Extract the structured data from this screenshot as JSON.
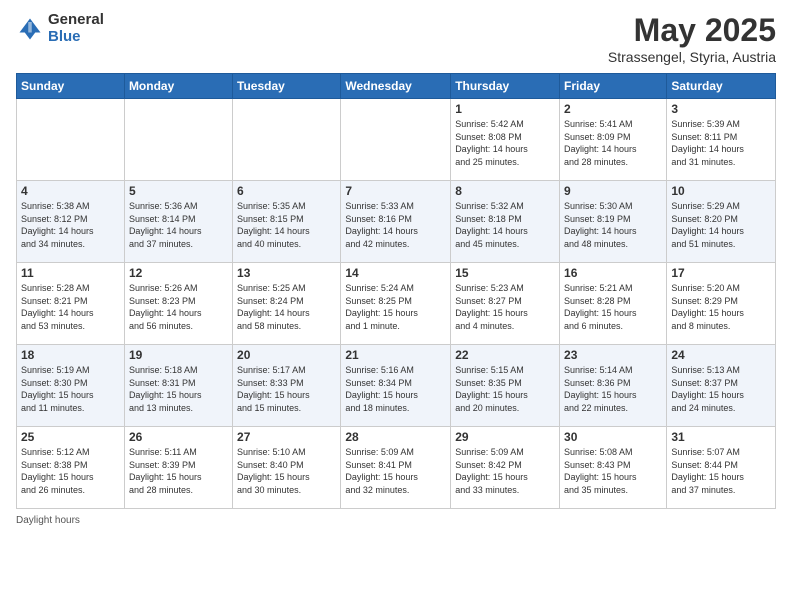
{
  "header": {
    "logo_general": "General",
    "logo_blue": "Blue",
    "title": "May 2025",
    "location": "Strassengel, Styria, Austria"
  },
  "days_of_week": [
    "Sunday",
    "Monday",
    "Tuesday",
    "Wednesday",
    "Thursday",
    "Friday",
    "Saturday"
  ],
  "weeks": [
    [
      {
        "day": "",
        "info": ""
      },
      {
        "day": "",
        "info": ""
      },
      {
        "day": "",
        "info": ""
      },
      {
        "day": "",
        "info": ""
      },
      {
        "day": "1",
        "info": "Sunrise: 5:42 AM\nSunset: 8:08 PM\nDaylight: 14 hours\nand 25 minutes."
      },
      {
        "day": "2",
        "info": "Sunrise: 5:41 AM\nSunset: 8:09 PM\nDaylight: 14 hours\nand 28 minutes."
      },
      {
        "day": "3",
        "info": "Sunrise: 5:39 AM\nSunset: 8:11 PM\nDaylight: 14 hours\nand 31 minutes."
      }
    ],
    [
      {
        "day": "4",
        "info": "Sunrise: 5:38 AM\nSunset: 8:12 PM\nDaylight: 14 hours\nand 34 minutes."
      },
      {
        "day": "5",
        "info": "Sunrise: 5:36 AM\nSunset: 8:14 PM\nDaylight: 14 hours\nand 37 minutes."
      },
      {
        "day": "6",
        "info": "Sunrise: 5:35 AM\nSunset: 8:15 PM\nDaylight: 14 hours\nand 40 minutes."
      },
      {
        "day": "7",
        "info": "Sunrise: 5:33 AM\nSunset: 8:16 PM\nDaylight: 14 hours\nand 42 minutes."
      },
      {
        "day": "8",
        "info": "Sunrise: 5:32 AM\nSunset: 8:18 PM\nDaylight: 14 hours\nand 45 minutes."
      },
      {
        "day": "9",
        "info": "Sunrise: 5:30 AM\nSunset: 8:19 PM\nDaylight: 14 hours\nand 48 minutes."
      },
      {
        "day": "10",
        "info": "Sunrise: 5:29 AM\nSunset: 8:20 PM\nDaylight: 14 hours\nand 51 minutes."
      }
    ],
    [
      {
        "day": "11",
        "info": "Sunrise: 5:28 AM\nSunset: 8:21 PM\nDaylight: 14 hours\nand 53 minutes."
      },
      {
        "day": "12",
        "info": "Sunrise: 5:26 AM\nSunset: 8:23 PM\nDaylight: 14 hours\nand 56 minutes."
      },
      {
        "day": "13",
        "info": "Sunrise: 5:25 AM\nSunset: 8:24 PM\nDaylight: 14 hours\nand 58 minutes."
      },
      {
        "day": "14",
        "info": "Sunrise: 5:24 AM\nSunset: 8:25 PM\nDaylight: 15 hours\nand 1 minute."
      },
      {
        "day": "15",
        "info": "Sunrise: 5:23 AM\nSunset: 8:27 PM\nDaylight: 15 hours\nand 4 minutes."
      },
      {
        "day": "16",
        "info": "Sunrise: 5:21 AM\nSunset: 8:28 PM\nDaylight: 15 hours\nand 6 minutes."
      },
      {
        "day": "17",
        "info": "Sunrise: 5:20 AM\nSunset: 8:29 PM\nDaylight: 15 hours\nand 8 minutes."
      }
    ],
    [
      {
        "day": "18",
        "info": "Sunrise: 5:19 AM\nSunset: 8:30 PM\nDaylight: 15 hours\nand 11 minutes."
      },
      {
        "day": "19",
        "info": "Sunrise: 5:18 AM\nSunset: 8:31 PM\nDaylight: 15 hours\nand 13 minutes."
      },
      {
        "day": "20",
        "info": "Sunrise: 5:17 AM\nSunset: 8:33 PM\nDaylight: 15 hours\nand 15 minutes."
      },
      {
        "day": "21",
        "info": "Sunrise: 5:16 AM\nSunset: 8:34 PM\nDaylight: 15 hours\nand 18 minutes."
      },
      {
        "day": "22",
        "info": "Sunrise: 5:15 AM\nSunset: 8:35 PM\nDaylight: 15 hours\nand 20 minutes."
      },
      {
        "day": "23",
        "info": "Sunrise: 5:14 AM\nSunset: 8:36 PM\nDaylight: 15 hours\nand 22 minutes."
      },
      {
        "day": "24",
        "info": "Sunrise: 5:13 AM\nSunset: 8:37 PM\nDaylight: 15 hours\nand 24 minutes."
      }
    ],
    [
      {
        "day": "25",
        "info": "Sunrise: 5:12 AM\nSunset: 8:38 PM\nDaylight: 15 hours\nand 26 minutes."
      },
      {
        "day": "26",
        "info": "Sunrise: 5:11 AM\nSunset: 8:39 PM\nDaylight: 15 hours\nand 28 minutes."
      },
      {
        "day": "27",
        "info": "Sunrise: 5:10 AM\nSunset: 8:40 PM\nDaylight: 15 hours\nand 30 minutes."
      },
      {
        "day": "28",
        "info": "Sunrise: 5:09 AM\nSunset: 8:41 PM\nDaylight: 15 hours\nand 32 minutes."
      },
      {
        "day": "29",
        "info": "Sunrise: 5:09 AM\nSunset: 8:42 PM\nDaylight: 15 hours\nand 33 minutes."
      },
      {
        "day": "30",
        "info": "Sunrise: 5:08 AM\nSunset: 8:43 PM\nDaylight: 15 hours\nand 35 minutes."
      },
      {
        "day": "31",
        "info": "Sunrise: 5:07 AM\nSunset: 8:44 PM\nDaylight: 15 hours\nand 37 minutes."
      }
    ]
  ],
  "legend": {
    "daylight_label": "Daylight hours"
  }
}
